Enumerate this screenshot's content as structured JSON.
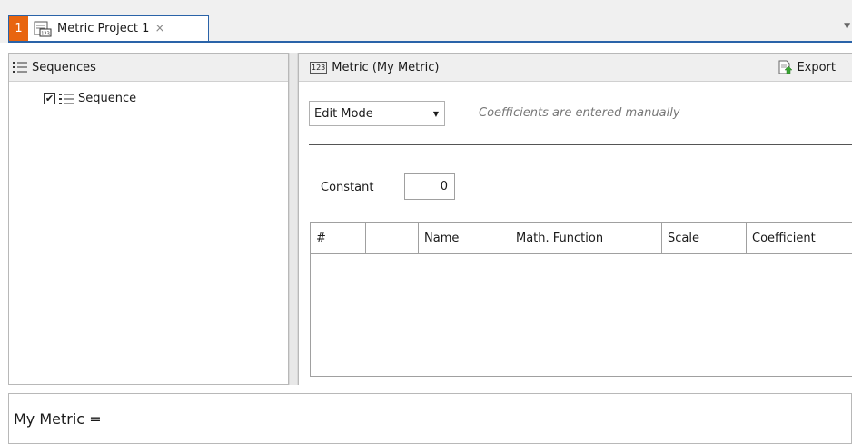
{
  "tab": {
    "number": "1",
    "title": "Metric Project 1",
    "close_glyph": "×",
    "icon": "metric-project-icon",
    "accent_color": "#e8650f",
    "border_color": "#2a63a8"
  },
  "tabbar": {
    "overflow_glyph": "▼"
  },
  "sequences_pane": {
    "title": "Sequences",
    "items": [
      {
        "label": "Sequence",
        "checked": true
      }
    ]
  },
  "metric_pane": {
    "title": "Metric (My Metric)",
    "icon_text": "123",
    "export_label": "Export",
    "mode": {
      "value": "Edit Mode",
      "hint": "Coefficients are entered manually"
    },
    "constant": {
      "label": "Constant",
      "value": "0"
    },
    "table": {
      "columns": [
        "#",
        "",
        "Name",
        "Math. Function",
        "Scale",
        "Coefficient"
      ],
      "rows": []
    }
  },
  "formula": {
    "text": "My Metric ="
  }
}
